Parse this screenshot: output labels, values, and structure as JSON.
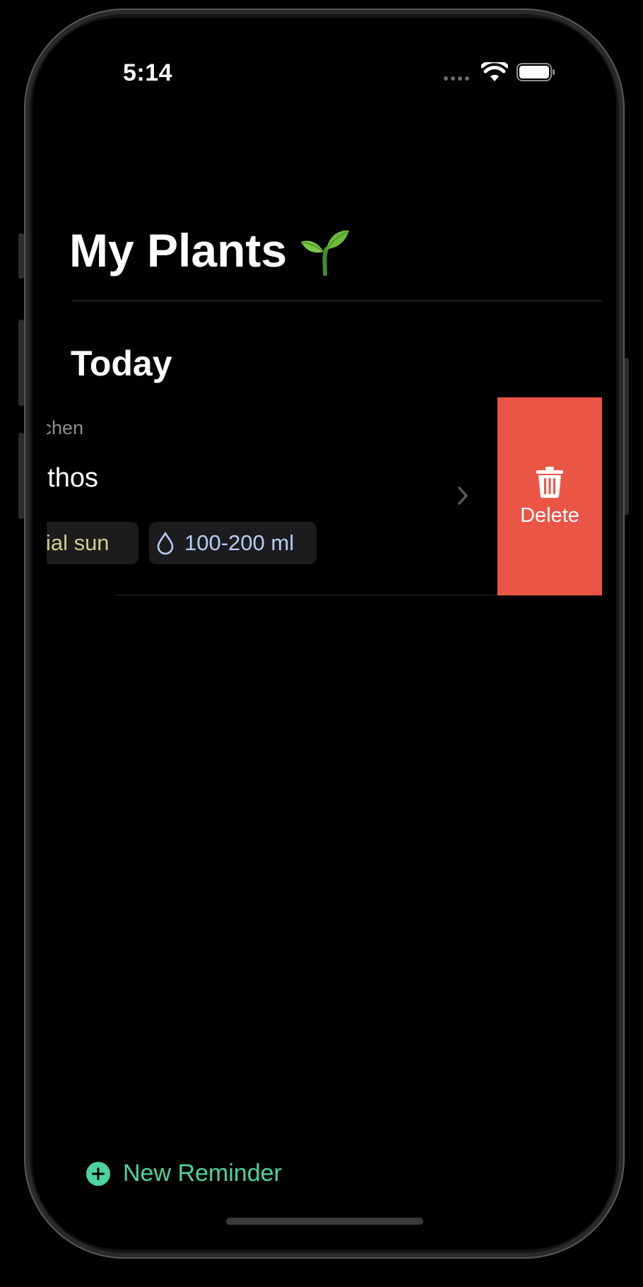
{
  "status_bar": {
    "time": "5:14"
  },
  "header": {
    "title": "My Plants",
    "title_icon": "sprout-icon"
  },
  "section": {
    "title": "Today"
  },
  "plant_row": {
    "location": "itchen",
    "name": "othos",
    "sun_chip": "rtial sun",
    "water_chip": "100-200 ml",
    "water_icon": "water-drop-icon"
  },
  "swipe_action": {
    "label": "Delete",
    "icon": "trash-icon",
    "color": "#eb5545"
  },
  "footer": {
    "new_reminder_label": "New Reminder",
    "icon": "plus-circle-icon",
    "accent_color": "#4cd4a0"
  }
}
